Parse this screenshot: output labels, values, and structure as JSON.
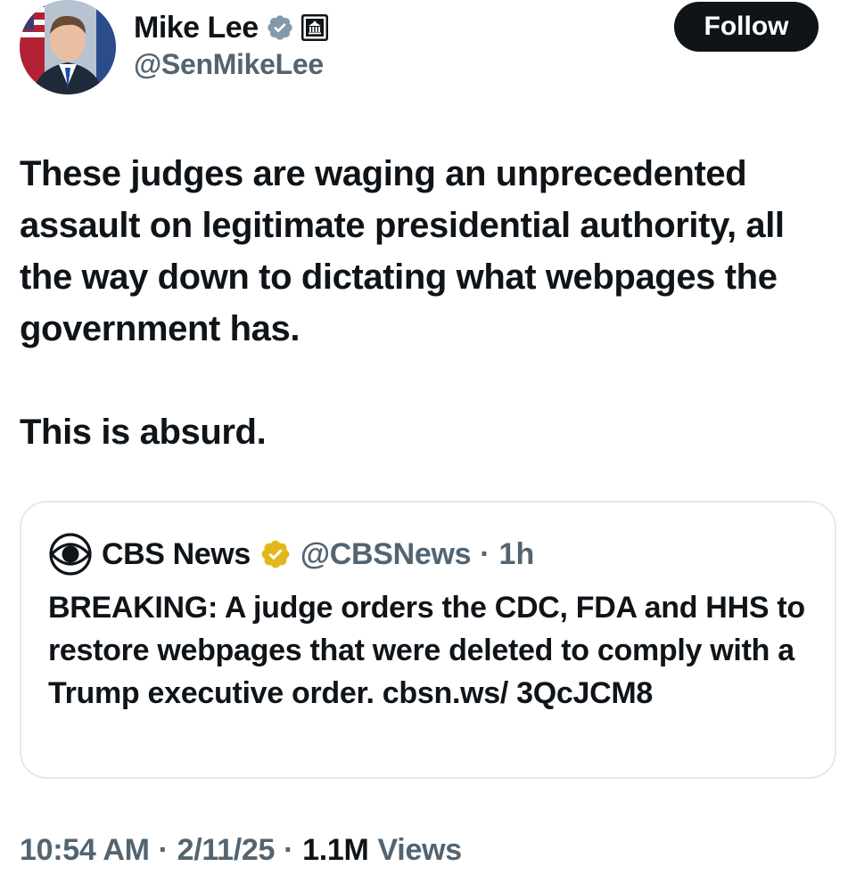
{
  "author": {
    "display_name": "Mike Lee",
    "handle": "@SenMikeLee",
    "verified_badge": "verified-gray-icon",
    "affiliation_badge": "government-building-icon"
  },
  "follow_label": "Follow",
  "tweet": {
    "paragraphs": [
      "These judges are waging an unprecedented assault on legitimate presidential authority, all the way down to dictating what webpages the government has.",
      "This is absurd."
    ]
  },
  "quote": {
    "logo": "cbs-eye-icon",
    "display_name": "CBS News",
    "verified_badge": "verified-gold-icon",
    "handle": "@CBSNews",
    "separator": "·",
    "time": "1h",
    "text": "BREAKING: A judge orders the CDC, FDA and HHS to restore webpages that were deleted to comply with a Trump executive order. cbsn.ws/ 3QcJCM8"
  },
  "meta": {
    "time": "10:54 AM",
    "sep1": "·",
    "date": "2/11/25",
    "sep2": "·",
    "views_count": "1.1M",
    "views_label": "Views"
  },
  "colors": {
    "text": "#0f1419",
    "secondary": "#536471",
    "border": "#e6e9ec",
    "follow_bg": "#0f1419",
    "gray_badge": "#829aab",
    "gold_badge": "#e2b719"
  }
}
